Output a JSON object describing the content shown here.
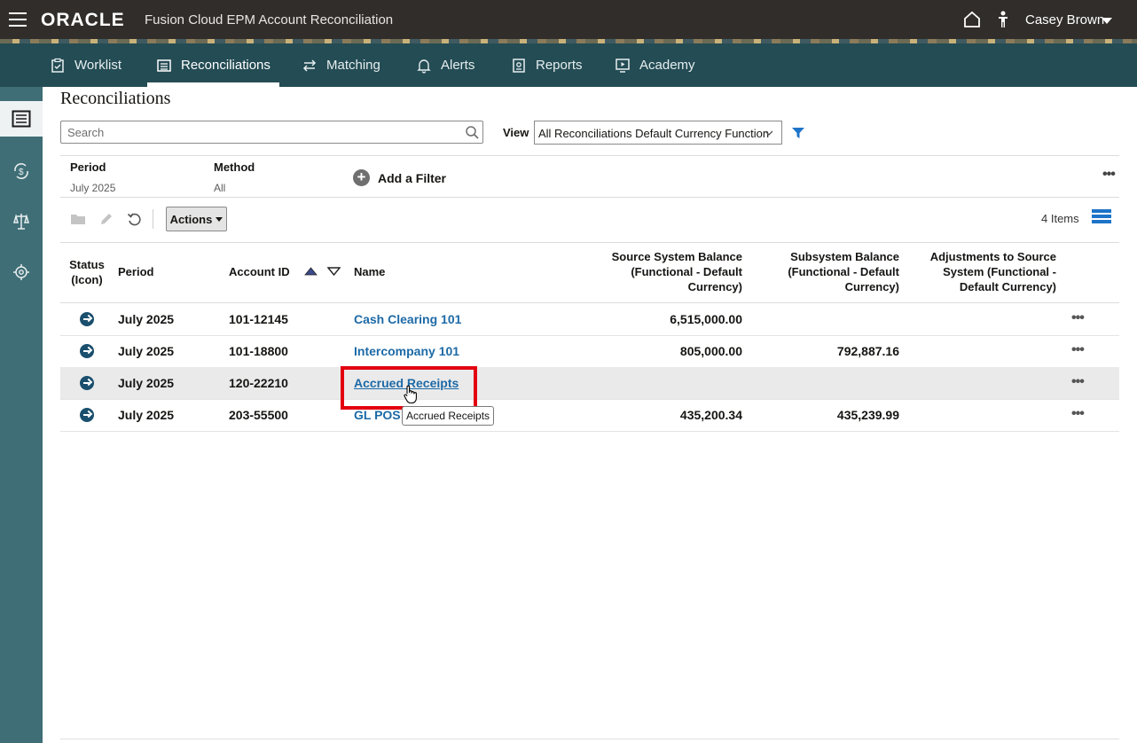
{
  "header": {
    "logo": "ORACLE",
    "app_title": "Fusion Cloud EPM Account Reconciliation",
    "user_name": "Casey Brown"
  },
  "nav": {
    "tabs": [
      {
        "label": "Worklist",
        "icon": "clipboard-check-icon",
        "active": false
      },
      {
        "label": "Reconciliations",
        "icon": "list-table-icon",
        "active": true
      },
      {
        "label": "Matching",
        "icon": "matching-arrows-icon",
        "active": false
      },
      {
        "label": "Alerts",
        "icon": "bell-icon",
        "active": false
      },
      {
        "label": "Reports",
        "icon": "report-icon",
        "active": false
      },
      {
        "label": "Academy",
        "icon": "play-screen-icon",
        "active": false
      }
    ]
  },
  "page": {
    "title": "Reconciliations",
    "search_placeholder": "Search",
    "view_label": "View",
    "view_value": "All Reconciliations Default Currency Function"
  },
  "filters": {
    "period_label": "Period",
    "period_value": "July 2025",
    "method_label": "Method",
    "method_value": "All",
    "add_filter_label": "Add a Filter"
  },
  "toolbar": {
    "actions_label": "Actions",
    "item_count": "4 Items"
  },
  "table": {
    "headers": {
      "status_line1": "Status",
      "status_line2": "(Icon)",
      "period": "Period",
      "account_id": "Account ID",
      "name": "Name",
      "source_line1": "Source System Balance",
      "source_line2": "(Functional - Default",
      "source_line3": "Currency)",
      "subsystem_line1": "Subsystem Balance",
      "subsystem_line2": "(Functional - Default",
      "subsystem_line3": "Currency)",
      "adjust_line1": "Adjustments to Source",
      "adjust_line2": "System (Functional -",
      "adjust_line3": "Default Currency)"
    },
    "rows": [
      {
        "period": "July 2025",
        "account_id": "101-12145",
        "name": "Cash Clearing 101",
        "source_balance": "6,515,000.00",
        "subsystem_balance": "",
        "adjustments": ""
      },
      {
        "period": "July 2025",
        "account_id": "101-18800",
        "name": "Intercompany 101",
        "source_balance": "805,000.00",
        "subsystem_balance": "792,887.16",
        "adjustments": ""
      },
      {
        "period": "July 2025",
        "account_id": "120-22210",
        "name": "Accrued Receipts",
        "source_balance": "",
        "subsystem_balance": "",
        "adjustments": ""
      },
      {
        "period": "July 2025",
        "account_id": "203-55500",
        "name": "GL POS",
        "source_balance": "435,200.34",
        "subsystem_balance": "435,239.99",
        "adjustments": ""
      }
    ]
  },
  "tooltip": "Accrued Receipts",
  "colors": {
    "topbar": "#312d2a",
    "navbar": "#244c54",
    "rail": "#3f6e76",
    "link": "#1d6aa6",
    "highlight": "#e3000f"
  }
}
